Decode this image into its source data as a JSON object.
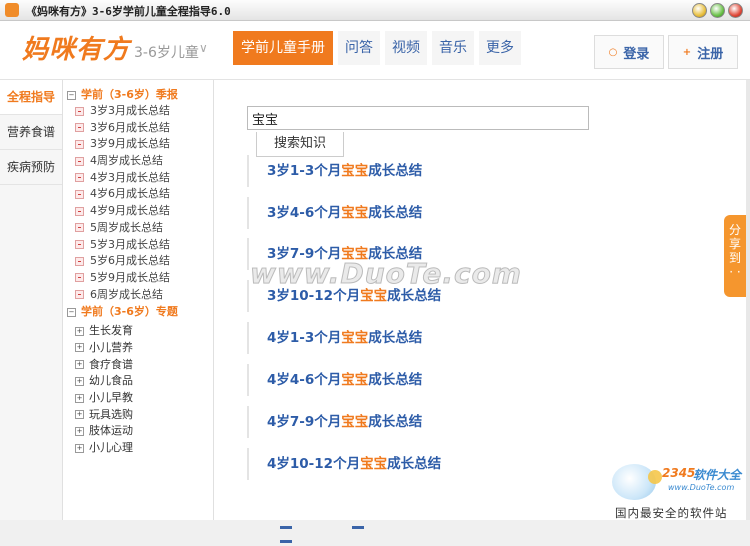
{
  "window": {
    "title": "《妈咪有方》3-6岁学前儿童全程指导6.0"
  },
  "header": {
    "logo": "妈咪有方",
    "age_label": "3-6岁儿童",
    "nav": [
      {
        "label": "学前儿童手册",
        "active": true
      },
      {
        "label": "问答",
        "active": false
      },
      {
        "label": "视频",
        "active": false
      },
      {
        "label": "音乐",
        "active": false
      },
      {
        "label": "更多",
        "active": false
      }
    ],
    "login_label": "登录",
    "register_label": "注册"
  },
  "leftnav": [
    {
      "label": "全程指导",
      "active": true
    },
    {
      "label": "营养食谱",
      "active": false
    },
    {
      "label": "疾病预防",
      "active": false
    }
  ],
  "tree": {
    "group1": {
      "label": "学前（3-6岁）季报",
      "items": [
        "3岁3月成长总结",
        "3岁6月成长总结",
        "3岁9月成长总结",
        "4周岁成长总结",
        "4岁3月成长总结",
        "4岁6月成长总结",
        "4岁9月成长总结",
        "5周岁成长总结",
        "5岁3月成长总结",
        "5岁6月成长总结",
        "5岁9月成长总结",
        "6周岁成长总结"
      ]
    },
    "group2": {
      "label": "学前（3-6岁）专题",
      "items": [
        "生长发育",
        "小儿营养",
        "食疗食谱",
        "幼儿食品",
        "小儿早教",
        "玩具选购",
        "肢体运动",
        "小儿心理"
      ]
    }
  },
  "search": {
    "value": "宝宝",
    "button_label": "搜索知识"
  },
  "results": [
    {
      "pre": "3岁1-3个月",
      "hl": "宝宝",
      "post": "成长总结"
    },
    {
      "pre": "3岁4-6个月",
      "hl": "宝宝",
      "post": "成长总结"
    },
    {
      "pre": "3岁7-9个月",
      "hl": "宝宝",
      "post": "成长总结"
    },
    {
      "pre": "3岁10-12个月",
      "hl": "宝宝",
      "post": "成长总结"
    },
    {
      "pre": "4岁1-3个月",
      "hl": "宝宝",
      "post": "成长总结"
    },
    {
      "pre": "4岁4-6个月",
      "hl": "宝宝",
      "post": "成长总结"
    },
    {
      "pre": "4岁7-9个月",
      "hl": "宝宝",
      "post": "成长总结"
    },
    {
      "pre": "4岁10-12个月",
      "hl": "宝宝",
      "post": "成长总结"
    }
  ],
  "share": {
    "label": "分享到",
    "more": "·  ·"
  },
  "watermarks": {
    "main": "www.DuoTe.com",
    "brand_digits": "2345",
    "brand_text": "软件大全",
    "brand_site": "www.DuoTe.com",
    "slogan": "国内最安全的软件站"
  },
  "colors": {
    "accent": "#f07a1e",
    "link": "#2d5ca8"
  }
}
